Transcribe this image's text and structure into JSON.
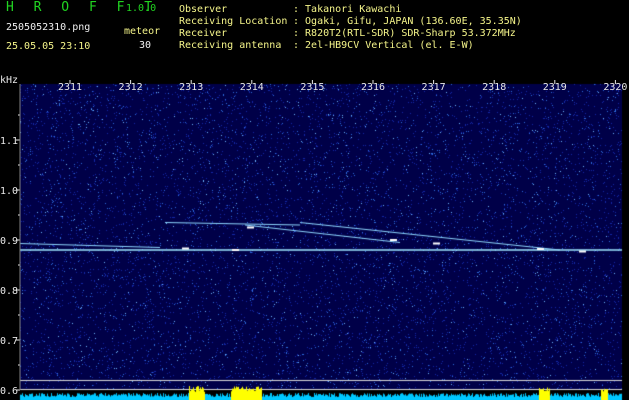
{
  "header": {
    "app_name": "H R O F F T",
    "version": "1.0.0",
    "filename": "2505052310.png",
    "datetime": "25.05.05 23:10",
    "meteor_label": "meteor",
    "meteor_count": "30",
    "info": [
      {
        "key": "Observer",
        "value": ": Takanori Kawachi"
      },
      {
        "key": "Receiving Location",
        "value": ": Ogaki, Gifu, JAPAN (136.60E, 35.35N)"
      },
      {
        "key": "Receiver",
        "value": ": R820T2(RTL-SDR) SDR-Sharp 53.372MHz"
      },
      {
        "key": "Receiving antenna",
        "value": ": 2el-HB9CV Vertical (el. E-W)"
      }
    ]
  },
  "spectrogram": {
    "y_unit": "kHz",
    "y_ticks": [
      "1.1",
      "1.0",
      "0.9",
      "0.8",
      "0.7",
      "0.6"
    ],
    "x_ticks": [
      "2311",
      "2312",
      "2313",
      "2314",
      "2315",
      "2316",
      "2317",
      "2318",
      "2319",
      "2320"
    ],
    "colors": {
      "background": "#000048",
      "carrier": "#9fe8ff",
      "meteor": "#ffffff",
      "noise_bar": "#00c8ff",
      "burst": "#ffff00"
    }
  }
}
